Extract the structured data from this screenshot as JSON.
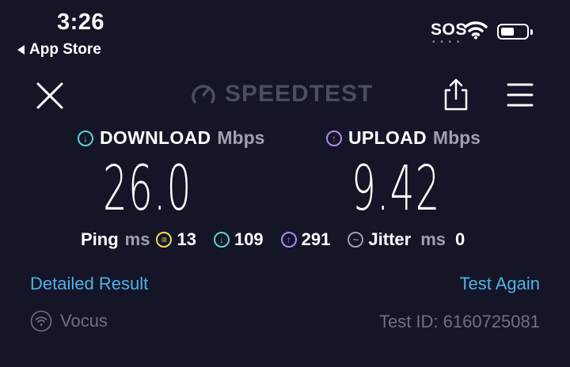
{
  "status_bar": {
    "time": "3:26",
    "back_label": "App Store",
    "carrier": "SOS",
    "battery_level": 0.4
  },
  "nav": {
    "logo_text": "SPEEDTEST",
    "icons": [
      "close-icon",
      "speedometer-icon",
      "share-icon",
      "menu-icon"
    ]
  },
  "download": {
    "label": "DOWNLOAD",
    "unit": "Mbps",
    "value": "26.0",
    "icon": "arrow-down-circle"
  },
  "upload": {
    "label": "UPLOAD",
    "unit": "Mbps",
    "value": "9.42",
    "icon": "arrow-up-circle"
  },
  "ping": {
    "label": "Ping",
    "unit": "ms",
    "idle": "13",
    "download": "109",
    "upload": "291",
    "jitter_label": "Jitter",
    "jitter_unit": "ms",
    "jitter": "0"
  },
  "links": {
    "detailed": "Detailed Result",
    "again": "Test Again"
  },
  "footer": {
    "provider": "Vocus",
    "test_id": "Test ID: 6160725081"
  },
  "colors": {
    "background": "#141526",
    "accent": "#4fb1ea",
    "download": "#5dd3d6",
    "upload": "#b088f5",
    "ping": "#f0e04d"
  }
}
